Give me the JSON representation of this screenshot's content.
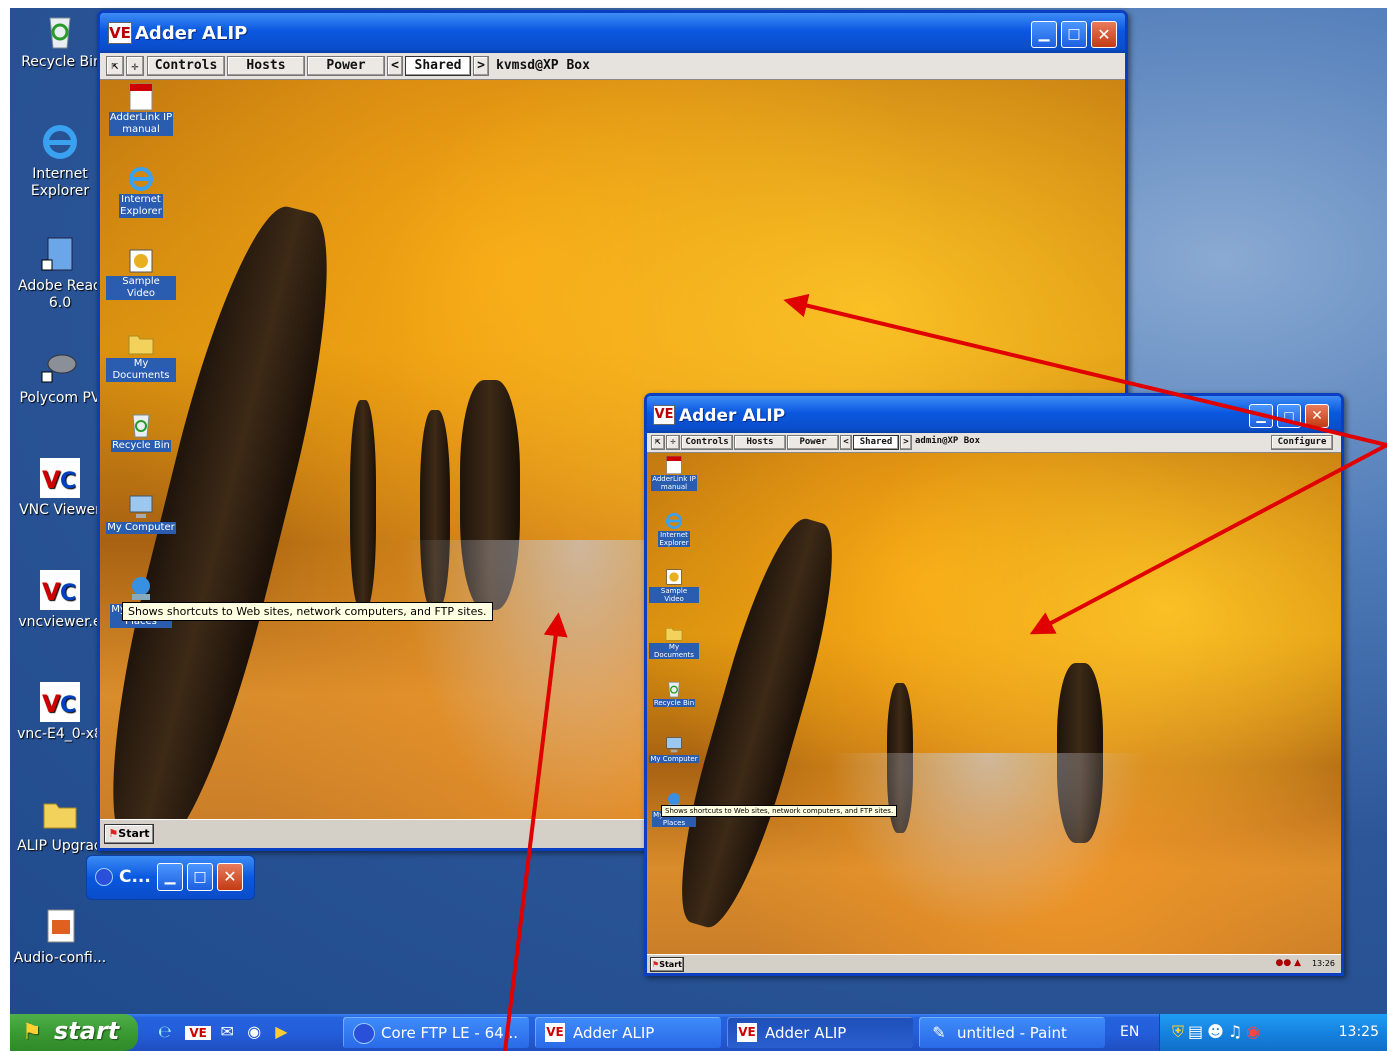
{
  "desktop": {
    "icons": [
      {
        "label": "Recycle Bir",
        "icon": "recycle-bin-icon"
      },
      {
        "label": "Internet\nExplorer",
        "icon": "internet-explorer-icon"
      },
      {
        "label": "Adobe Read\n6.0",
        "icon": "adobe-reader-icon"
      },
      {
        "label": "Polycom PV",
        "icon": "polycom-icon"
      },
      {
        "label": "VNC Viewer",
        "icon": "vnc-viewer-icon"
      },
      {
        "label": "vncviewer.e",
        "icon": "vnc-viewer-icon"
      },
      {
        "label": "vnc-E4_0-x8",
        "icon": "vnc-viewer-icon"
      },
      {
        "label": "ALIP Upgrad",
        "icon": "folder-icon"
      },
      {
        "label": "Audio-confi...",
        "icon": "audio-config-icon"
      }
    ]
  },
  "window_main": {
    "title": "Adder ALIP",
    "logo": "VE",
    "toolbar": {
      "controls": "Controls",
      "hosts": "Hosts",
      "power": "Power",
      "prev": "<",
      "shared": "Shared",
      "next": ">",
      "host_name": "kvmsd@XP Box"
    },
    "remote_icons": [
      {
        "label": "AdderLink IP\nmanual",
        "icon": "pdf-icon"
      },
      {
        "label": "Internet\nExplorer",
        "icon": "internet-explorer-icon"
      },
      {
        "label": "Sample Video",
        "icon": "video-icon"
      },
      {
        "label": "My Documents",
        "icon": "documents-folder-icon"
      },
      {
        "label": "Recycle Bin",
        "icon": "recycle-bin-icon"
      },
      {
        "label": "My Computer",
        "icon": "computer-icon"
      },
      {
        "label": "My Network\nPlaces",
        "icon": "network-icon"
      }
    ],
    "tooltip": "Shows shortcuts to Web sites, network computers, and FTP sites.",
    "start_label": "Start"
  },
  "window_second": {
    "title": "Adder ALIP",
    "logo": "VE",
    "toolbar": {
      "controls": "Controls",
      "hosts": "Hosts",
      "power": "Power",
      "prev": "<",
      "shared": "Shared",
      "next": ">",
      "host_name": "admin@XP Box",
      "configure": "Configure"
    },
    "remote_icons": [
      {
        "label": "AdderLink IP\nmanual",
        "icon": "pdf-icon"
      },
      {
        "label": "Internet\nExplorer",
        "icon": "internet-explorer-icon"
      },
      {
        "label": "Sample Video",
        "icon": "video-icon"
      },
      {
        "label": "My Documents",
        "icon": "documents-folder-icon"
      },
      {
        "label": "Recycle Bin",
        "icon": "recycle-bin-icon"
      },
      {
        "label": "My Computer",
        "icon": "computer-icon"
      },
      {
        "label": "My Network\nPlaces",
        "icon": "network-icon"
      }
    ],
    "tooltip": "Shows shortcuts to Web sites, network computers, and FTP sites.",
    "start_label": "Start",
    "clock": "13:26"
  },
  "mini_window": {
    "title": "C..."
  },
  "taskbar": {
    "start_label": "start",
    "tasks": [
      {
        "label": "Core FTP LE - 64...",
        "icon": "coreftp-icon"
      },
      {
        "label": "Adder ALIP",
        "icon": "vnc-viewer-icon"
      },
      {
        "label": "Adder ALIP",
        "icon": "vnc-viewer-icon"
      },
      {
        "label": "untitled - Paint",
        "icon": "paint-icon"
      }
    ],
    "language": "EN",
    "clock": "13:25"
  },
  "colors": {
    "xp_blue": "#0a58e0",
    "start_green": "#3a9a33",
    "annotation_red": "#e00000",
    "tooltip_yellow": "#ffffe1"
  }
}
